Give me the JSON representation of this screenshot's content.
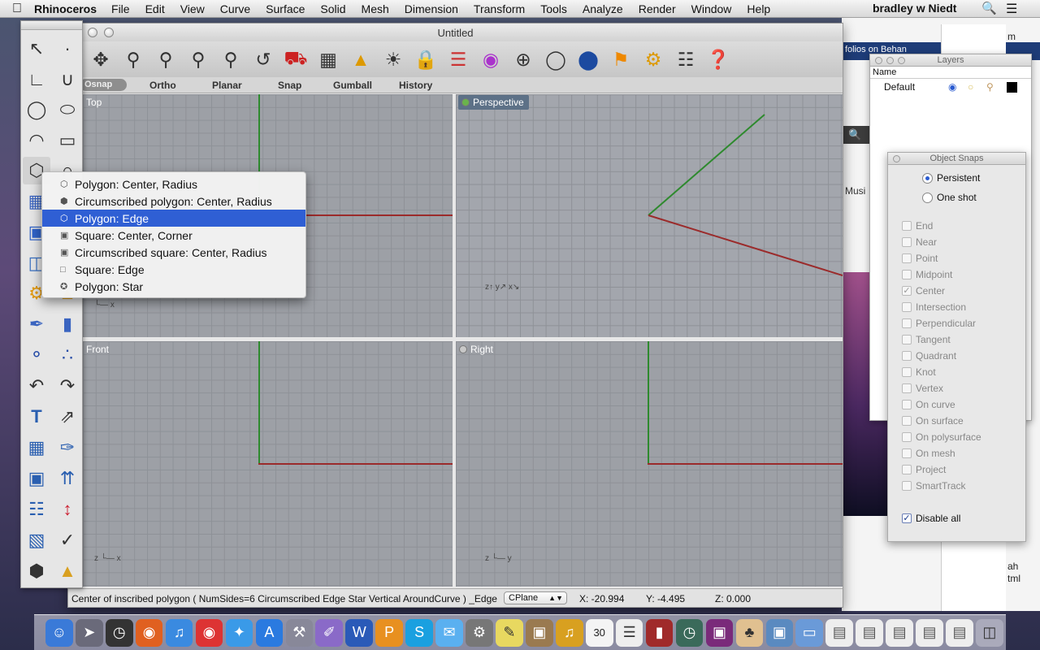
{
  "menubar": {
    "app_name": "Rhinoceros",
    "items": [
      "File",
      "Edit",
      "View",
      "Curve",
      "Surface",
      "Solid",
      "Mesh",
      "Dimension",
      "Transform",
      "Tools",
      "Analyze",
      "Render",
      "Window",
      "Help"
    ],
    "user": "bradley w Niedt"
  },
  "background": {
    "web_strip": "folios on Behan",
    "music_label": "Musi",
    "side_text_1": "ah",
    "side_text_2": "tml",
    "top_text": "m"
  },
  "window": {
    "title": "Untitled"
  },
  "toolbar": {
    "icons": [
      "pan-icon",
      "rotate-view-icon",
      "zoom-icon",
      "zoom-window-icon",
      "zoom-extents-icon",
      "zoom-selected-icon",
      "undo-view-icon",
      "car-named-views-icon",
      "cplane-icon",
      "gumball-icon",
      "light-icon",
      "lock-icon",
      "layer-icon",
      "color-wheel-icon",
      "wireframe-sphere-icon",
      "ghosted-sphere-icon",
      "shaded-sphere-icon",
      "render-flag-icon",
      "gear-options-icon",
      "snap-grid-icon",
      "help-icon"
    ]
  },
  "statebar": {
    "osnap": "Osnap",
    "ortho": "Ortho",
    "planar": "Planar",
    "snap": "Snap",
    "gumball": "Gumball",
    "history": "History"
  },
  "viewports": {
    "top": "Top",
    "perspective": "Perspective",
    "front": "Front",
    "right": "Right"
  },
  "flyout": {
    "items": [
      {
        "label": "Polygon: Center, Radius",
        "icon": "polygon-center-icon",
        "selected": false
      },
      {
        "label": "Circumscribed polygon: Center, Radius",
        "icon": "circumscribed-polygon-icon",
        "selected": false
      },
      {
        "label": "Polygon: Edge",
        "icon": "polygon-edge-icon",
        "selected": true
      },
      {
        "label": "Square: Center, Corner",
        "icon": "square-center-icon",
        "selected": false
      },
      {
        "label": "Circumscribed square: Center, Radius",
        "icon": "circumscribed-square-icon",
        "selected": false
      },
      {
        "label": "Square: Edge",
        "icon": "square-edge-icon",
        "selected": false
      },
      {
        "label": "Polygon: Star",
        "icon": "polygon-star-icon",
        "selected": false
      }
    ]
  },
  "command": {
    "prompt": "Center of inscribed polygon ( NumSides=6 Circumscribed Edge Star Vertical AroundCurve ) _Edge",
    "cplane": "CPlane",
    "x": "X: -20.994",
    "y": "Y: -4.495",
    "z": "Z: 0.000"
  },
  "layers_panel": {
    "title": "Layers",
    "header": "Name",
    "layer_name": "Default",
    "layer_color": "#000000"
  },
  "osnap_panel": {
    "title": "Object Snaps",
    "persistent": "Persistent",
    "one_shot": "One shot",
    "snaps": [
      {
        "label": "End",
        "checked": false
      },
      {
        "label": "Near",
        "checked": false
      },
      {
        "label": "Point",
        "checked": false
      },
      {
        "label": "Midpoint",
        "checked": false
      },
      {
        "label": "Center",
        "checked": true
      },
      {
        "label": "Intersection",
        "checked": false
      },
      {
        "label": "Perpendicular",
        "checked": false
      },
      {
        "label": "Tangent",
        "checked": false
      },
      {
        "label": "Quadrant",
        "checked": false
      },
      {
        "label": "Knot",
        "checked": false
      },
      {
        "label": "Vertex",
        "checked": false
      },
      {
        "label": "On curve",
        "checked": false
      },
      {
        "label": "On surface",
        "checked": false
      },
      {
        "label": "On polysurface",
        "checked": false
      },
      {
        "label": "On mesh",
        "checked": false
      },
      {
        "label": "Project",
        "checked": false
      },
      {
        "label": "SmartTrack",
        "checked": false
      }
    ],
    "disable_all": "Disable all",
    "disable_all_checked": true
  },
  "dock": {
    "items": [
      "finder-icon",
      "launchpad-icon",
      "dashboard-icon",
      "firefox-icon",
      "itunes-icon",
      "chrome-icon",
      "safari-icon",
      "app-store-icon",
      "xcode-icon",
      "art-app-icon",
      "word-icon",
      "pages-icon",
      "skype-icon",
      "messages-icon",
      "system-preferences-icon",
      "stickies-icon",
      "preview-icon",
      "garageband-icon",
      "calendar-icon",
      "reminders-icon",
      "book-icon",
      "time-machine-icon",
      "photo-booth-icon",
      "photos-icon",
      "iphoto-icon",
      "folder-icon",
      "document-icon",
      "document-2-icon",
      "document-3-icon",
      "document-4-icon",
      "document-5-icon",
      "trash-icon"
    ],
    "calendar_day": "30"
  },
  "colors": {
    "selection": "#2f5fd4",
    "x_axis": "#9b2b2b",
    "y_axis": "#2e8a2e",
    "viewport_bg": "#9da0a6"
  }
}
